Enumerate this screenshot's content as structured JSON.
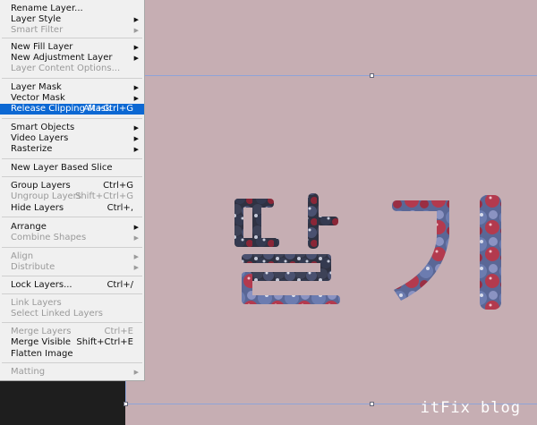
{
  "menu": {
    "items": [
      {
        "label": "Rename Layer...",
        "shortcut": "",
        "submenu": false,
        "disabled": false
      },
      {
        "label": "Layer Style",
        "shortcut": "",
        "submenu": true,
        "disabled": false
      },
      {
        "label": "Smart Filter",
        "shortcut": "",
        "submenu": true,
        "disabled": true
      },
      {
        "label": "New Fill Layer",
        "shortcut": "",
        "submenu": true,
        "disabled": false
      },
      {
        "label": "New Adjustment Layer",
        "shortcut": "",
        "submenu": true,
        "disabled": false
      },
      {
        "label": "Layer Content Options...",
        "shortcut": "",
        "submenu": false,
        "disabled": true
      },
      {
        "label": "Layer Mask",
        "shortcut": "",
        "submenu": true,
        "disabled": false
      },
      {
        "label": "Vector Mask",
        "shortcut": "",
        "submenu": true,
        "disabled": false
      },
      {
        "label": "Release Clipping Mask",
        "shortcut": "Alt+Ctrl+G",
        "submenu": false,
        "disabled": false,
        "highlighted": true
      },
      {
        "label": "Smart Objects",
        "shortcut": "",
        "submenu": true,
        "disabled": false
      },
      {
        "label": "Video Layers",
        "shortcut": "",
        "submenu": true,
        "disabled": false
      },
      {
        "label": "Rasterize",
        "shortcut": "",
        "submenu": true,
        "disabled": false
      },
      {
        "label": "New Layer Based Slice",
        "shortcut": "",
        "submenu": false,
        "disabled": false
      },
      {
        "label": "Group Layers",
        "shortcut": "Ctrl+G",
        "submenu": false,
        "disabled": false
      },
      {
        "label": "Ungroup Layers",
        "shortcut": "Shift+Ctrl+G",
        "submenu": false,
        "disabled": true
      },
      {
        "label": "Hide Layers",
        "shortcut": "Ctrl+,",
        "submenu": false,
        "disabled": false
      },
      {
        "label": "Arrange",
        "shortcut": "",
        "submenu": true,
        "disabled": false
      },
      {
        "label": "Combine Shapes",
        "shortcut": "",
        "submenu": true,
        "disabled": true
      },
      {
        "label": "Align",
        "shortcut": "",
        "submenu": true,
        "disabled": true
      },
      {
        "label": "Distribute",
        "shortcut": "",
        "submenu": true,
        "disabled": true
      },
      {
        "label": "Lock Layers...",
        "shortcut": "Ctrl+/",
        "submenu": false,
        "disabled": false
      },
      {
        "label": "Link Layers",
        "shortcut": "",
        "submenu": false,
        "disabled": true
      },
      {
        "label": "Select Linked Layers",
        "shortcut": "",
        "submenu": false,
        "disabled": true
      },
      {
        "label": "Merge Layers",
        "shortcut": "Ctrl+E",
        "submenu": false,
        "disabled": true
      },
      {
        "label": "Merge Visible",
        "shortcut": "Shift+Ctrl+E",
        "submenu": false,
        "disabled": false
      },
      {
        "label": "Flatten Image",
        "shortcut": "",
        "submenu": false,
        "disabled": false
      },
      {
        "label": "Matting",
        "shortcut": "",
        "submenu": true,
        "disabled": true
      }
    ]
  },
  "canvas": {
    "clipped_text": "딸기",
    "background_color": "#c6aeb3"
  },
  "watermark": "itFix blog",
  "colors": {
    "highlight": "#0c68d3",
    "disabled_text": "#9a9a9a",
    "guide": "#8fa4d8"
  }
}
